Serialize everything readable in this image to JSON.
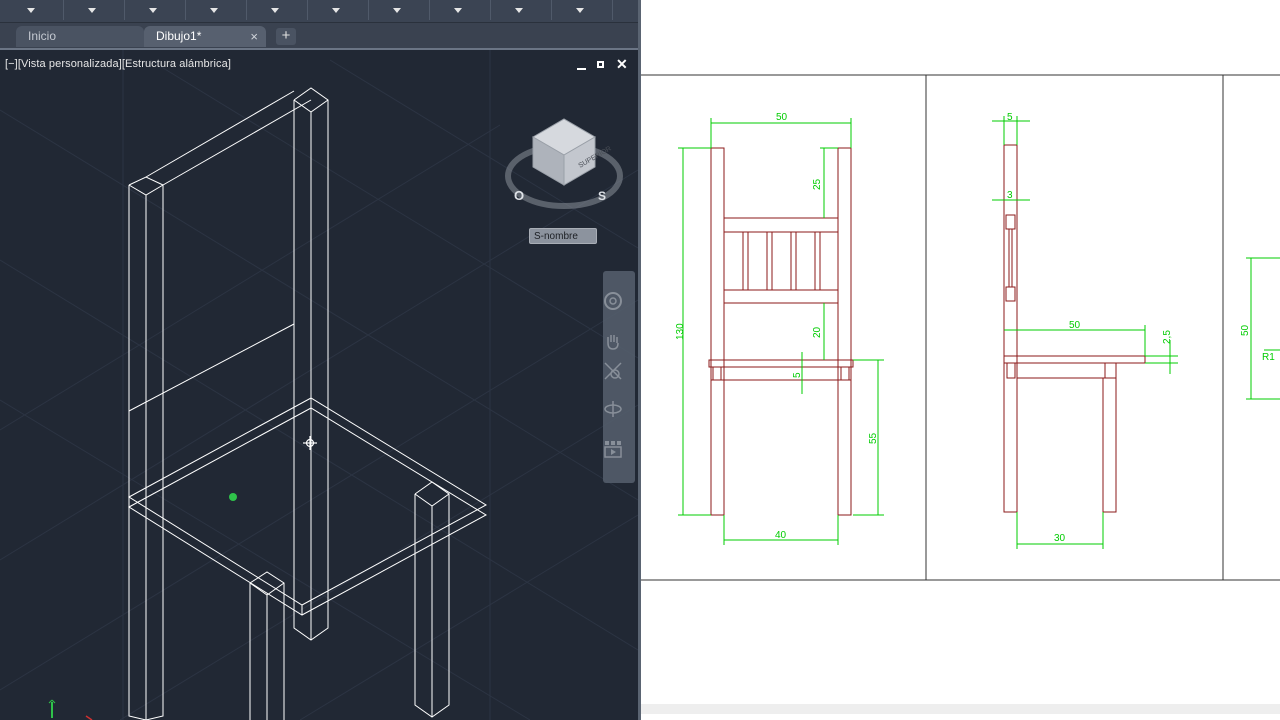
{
  "tabs": [
    {
      "label": "Inicio",
      "active": false
    },
    {
      "label": "Dibujo1*",
      "active": true
    }
  ],
  "viewport": {
    "label": "[−][Vista personalizada][Estructura alámbrica]"
  },
  "viewcube": {
    "face_label": "SUPERIOR",
    "compass": {
      "west": "O",
      "south": "S"
    },
    "named_view": "S-nombre"
  },
  "drawing": {
    "front": {
      "width_top": "50",
      "upper": "25",
      "total_height": "130",
      "lower": "20",
      "seat": "5",
      "leg": "55",
      "width_bottom": "40"
    },
    "side": {
      "top": "5",
      "mid": "3",
      "seat_depth": "50",
      "seat_thk": "2,5",
      "bottom": "30"
    },
    "right": {
      "height": "50",
      "radius": "R1"
    }
  },
  "colors": {
    "cad_background": "#212834",
    "wireframe": "#ffffff",
    "drawing_outline": "#8b1a1a",
    "dimension": "#00cc00"
  }
}
